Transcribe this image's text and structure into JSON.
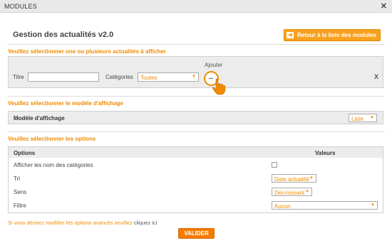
{
  "window": {
    "title": "MODULES",
    "close_label": "✕"
  },
  "header": {
    "title": "Gestion des actualités v2.0",
    "back_button": "Retour à la liste des modules",
    "back_icon": "chevron-left-icon"
  },
  "section_news": {
    "heading": "Veuillez sélectionner une ou plusieurs actualités à afficher",
    "add_label": "Ajouter",
    "titre_label": "Titre",
    "titre_value": "",
    "categories_label": "Catégories",
    "categories_value": "Toutes",
    "remove_label": "X"
  },
  "section_display": {
    "heading": "Veuillez sélectionner le modèle d'affichage",
    "model_label": "Modèle d'affichage",
    "model_value": "Liste"
  },
  "section_options": {
    "heading": "Veuillez sélectionner les options",
    "col_options": "Options",
    "col_values": "Valeurs",
    "rows": [
      {
        "label": "Afficher les nom des catégories",
        "type": "checkbox",
        "checked": false
      },
      {
        "label": "Tri",
        "type": "select",
        "value": "Date actualité"
      },
      {
        "label": "Sens",
        "type": "select",
        "value": "Décroissant"
      },
      {
        "label": "Filtre",
        "type": "select",
        "value": "Aucun"
      }
    ]
  },
  "footer": {
    "note": "Si vous désirez modifier les options avancés veuillez",
    "link": "cliquez ici",
    "submit": "VALIDER"
  },
  "colors": {
    "accent": "#f08a00",
    "button": "#f47b00",
    "panel": "#ececec"
  }
}
